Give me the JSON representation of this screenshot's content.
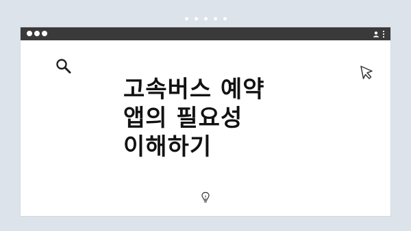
{
  "window": {
    "icons": {
      "top_dots": "pagination-dots",
      "window_controls": "traffic-light-dots",
      "user": "user-icon",
      "menu": "kebab-menu-icon"
    }
  },
  "content": {
    "title_lines": [
      "고속버스 예약",
      "앱의 필요성",
      "이해하기"
    ],
    "icons": {
      "search": "search-icon",
      "cursor": "cursor-icon",
      "lightbulb": "lightbulb-icon"
    }
  },
  "colors": {
    "background": "#dde3ea",
    "titlebar": "#3a3a3a",
    "window": "#ffffff",
    "text": "#121212"
  }
}
